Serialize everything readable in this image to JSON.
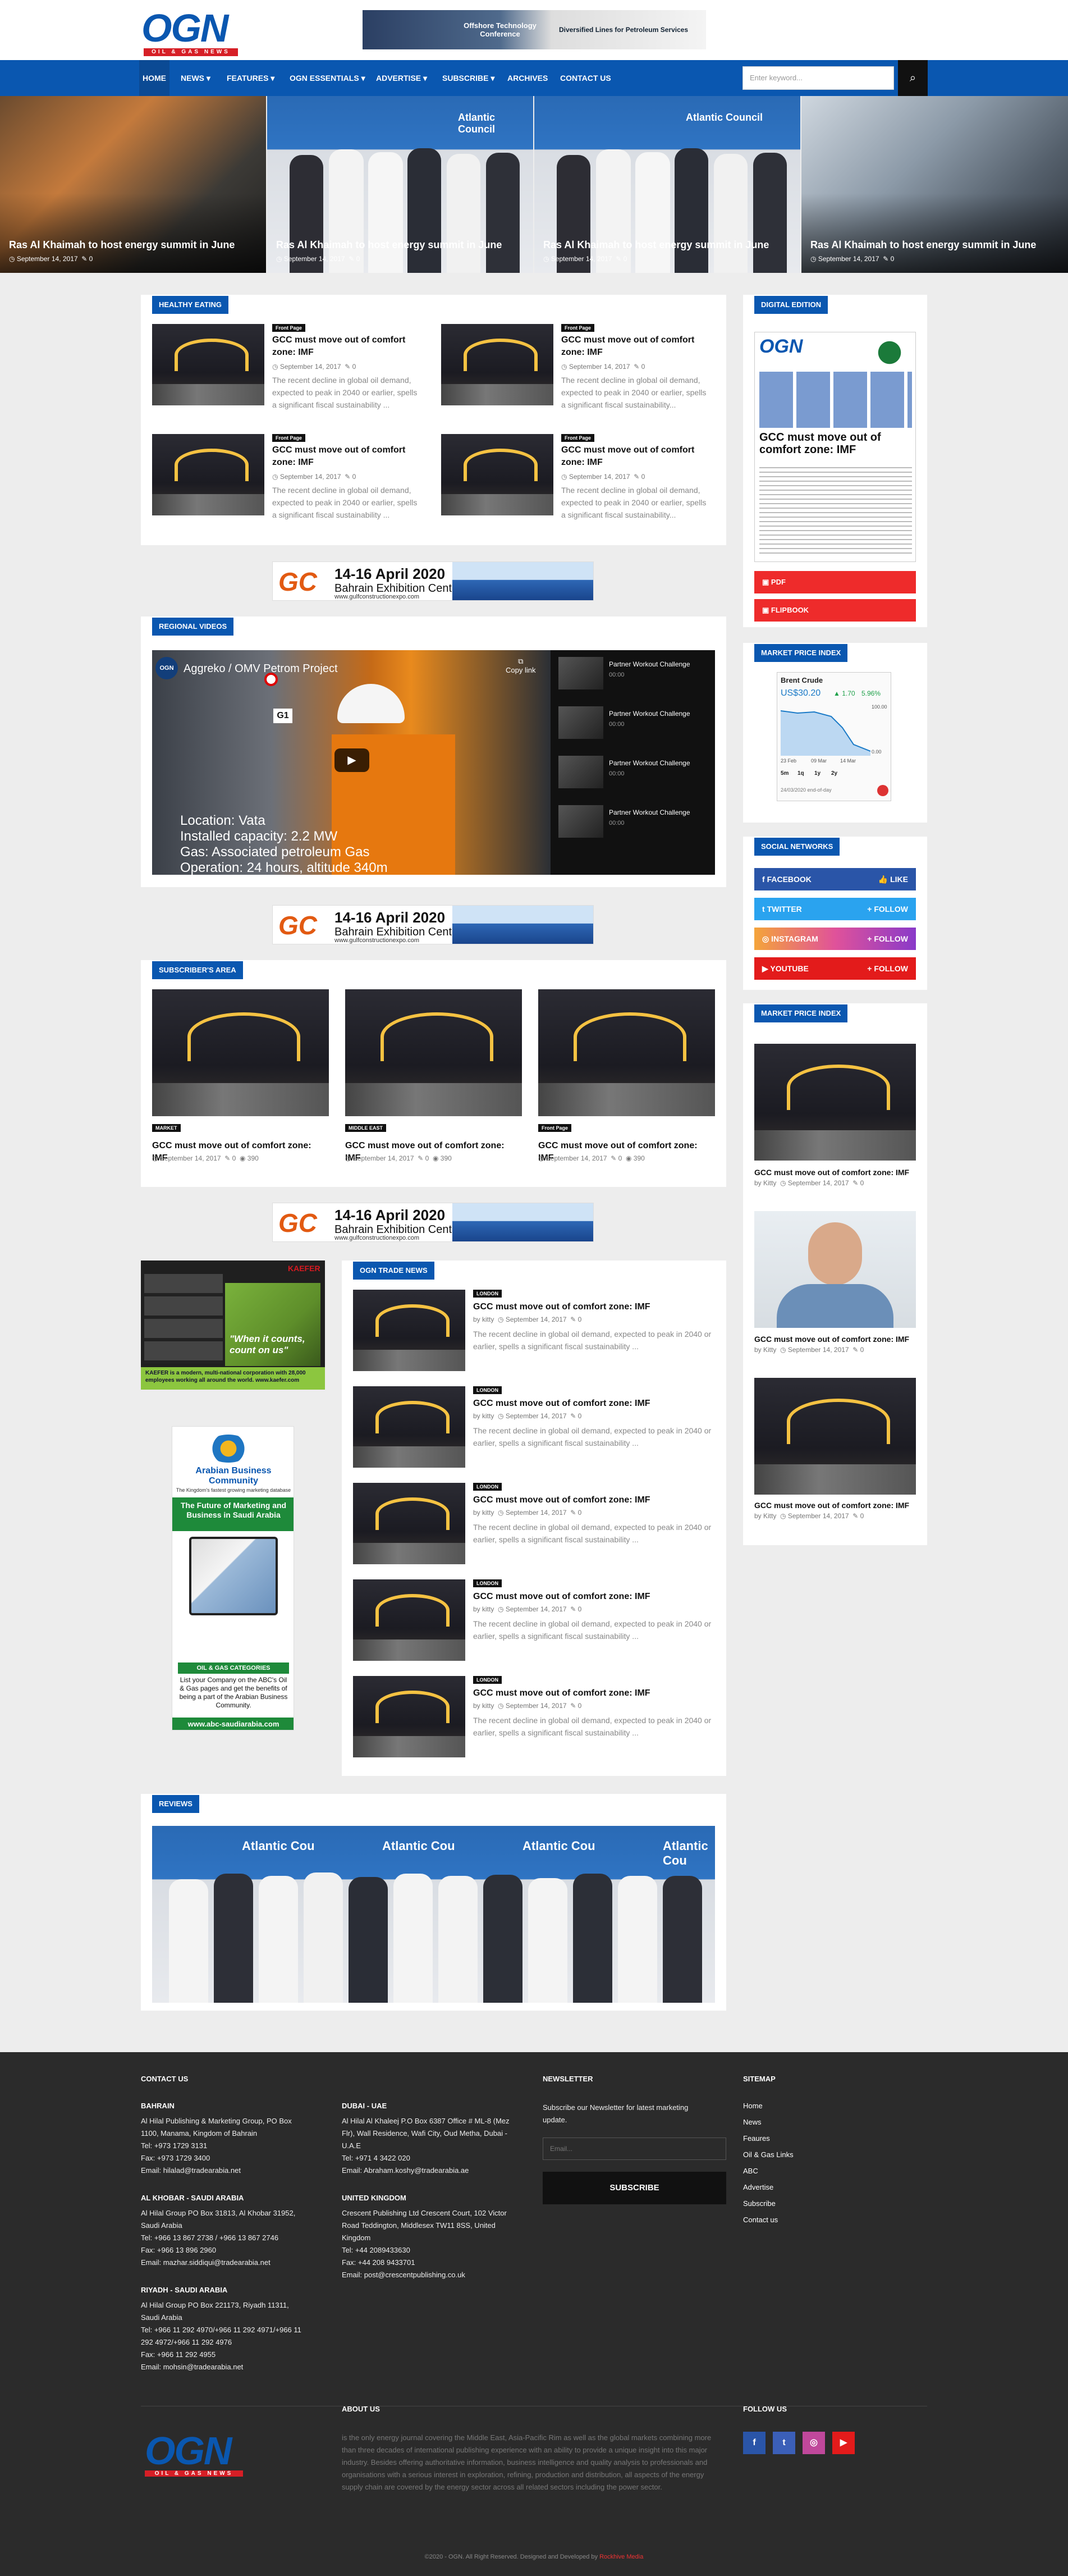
{
  "header": {
    "logo_text": "OGN",
    "logo_subtitle": "OIL & GAS NEWS",
    "ad_left": "Offshore Technology Conference",
    "ad_right": "Diversified Lines for Petroleum Services"
  },
  "nav": {
    "items": [
      "HOME",
      "NEWS ▾",
      "FEATURES ▾",
      "OGN ESSENTIALS ▾",
      "ADVERTISE ▾",
      "SUBSCRIBE ▾",
      "ARCHIVES",
      "CONTACT US"
    ],
    "search_placeholder": "Enter keyword...",
    "search_icon": "search-icon"
  },
  "hero": [
    {
      "title": "Ras Al Khaimah to host energy summit in June",
      "date": "September 14, 2017",
      "comments": "0"
    },
    {
      "title": "Ras Al Khaimah to host energy summit in June",
      "date": "September 14, 2017",
      "comments": "0"
    },
    {
      "title": "Ras Al Khaimah to host energy summit in June",
      "date": "September 14, 2017",
      "comments": "0"
    },
    {
      "title": "Ras Al Khaimah to host energy summit in June",
      "date": "September 14, 2017",
      "comments": "0"
    }
  ],
  "hero_overlay": "Atlantic Council",
  "healthy": {
    "tag": "HEALTHY EATING",
    "items": [
      {
        "label": "Front Page",
        "title": "GCC must move out of comfort zone: IMF",
        "date": "September 14, 2017",
        "comments": "0",
        "excerpt": "The recent decline in global oil demand, expected to peak in 2040 or earlier, spells a significant fiscal sustainability ..."
      },
      {
        "label": "Front Page",
        "title": "GCC must move out of comfort zone: IMF",
        "date": "September 14, 2017",
        "comments": "0",
        "excerpt": "The recent decline in global oil demand, expected to peak in 2040 or earlier, spells a significant fiscal sustainability..."
      },
      {
        "label": "Front Page",
        "title": "GCC must move out of comfort zone: IMF",
        "date": "September 14, 2017",
        "comments": "0",
        "excerpt": "The recent decline in global oil demand, expected to peak in 2040 or earlier, spells a significant fiscal sustainability ..."
      },
      {
        "label": "Front Page",
        "title": "GCC must move out of comfort zone: IMF",
        "date": "September 14, 2017",
        "comments": "0",
        "excerpt": "The recent decline in global oil demand, expected to peak in 2040 or earlier, spells a significant fiscal sustainability..."
      }
    ]
  },
  "banner": {
    "logo": "GC",
    "dates": "14-16 April 2020",
    "venue": "Bahrain Exhibition Centre",
    "url": "www.gulfconstructionexpo.com"
  },
  "videos": {
    "tag": "REGIONAL VIDEOS",
    "main_title": "Aggreko / OMV Petrom Project",
    "copy_link": "Copy link",
    "caption": [
      "Location: Vata",
      "Installed capacity: 2.2 MW",
      "Gas: Associated petroleum Gas",
      "Operation: 24 hours, altitude 340m"
    ],
    "sign": "G1",
    "list": [
      {
        "title": "Partner Workout Challenge",
        "time": "00:00"
      },
      {
        "title": "Partner Workout Challenge",
        "time": "00:00"
      },
      {
        "title": "Partner Workout Challenge",
        "time": "00:00"
      },
      {
        "title": "Partner Workout Challenge",
        "time": "00:00"
      }
    ]
  },
  "subscribers": {
    "tag": "SUBSCRIBER'S AREA",
    "items": [
      {
        "label": "MARKET",
        "title": "GCC must move out of comfort zone: IMF",
        "date": "September 14, 2017",
        "comments": "0",
        "views": "390"
      },
      {
        "label": "MIDDLE EAST",
        "title": "GCC must move out of comfort zone: IMF",
        "date": "September 14, 2017",
        "comments": "0",
        "views": "390"
      },
      {
        "label": "Front Page",
        "title": "GCC must move out of comfort zone: IMF",
        "date": "September 14, 2017",
        "comments": "0",
        "views": "390"
      }
    ]
  },
  "trade": {
    "tag": "OGN TRADE NEWS",
    "items": [
      {
        "label": "LONDON",
        "title": "GCC must move out of comfort zone: IMF",
        "author": "by kitty",
        "date": "September 14, 2017",
        "comments": "0",
        "excerpt": "The recent decline in global oil demand, expected to peak in 2040 or earlier, spells a significant fiscal sustainability ..."
      },
      {
        "label": "LONDON",
        "title": "GCC must move out of comfort zone: IMF",
        "author": "by kitty",
        "date": "September 14, 2017",
        "comments": "0",
        "excerpt": "The recent decline in global oil demand, expected to peak in 2040 or earlier, spells a significant fiscal sustainability ..."
      },
      {
        "label": "LONDON",
        "title": "GCC must move out of comfort zone: IMF",
        "author": "by kitty",
        "date": "September 14, 2017",
        "comments": "0",
        "excerpt": "The recent decline in global oil demand, expected to peak in 2040 or earlier, spells a significant fiscal sustainability ..."
      },
      {
        "label": "LONDON",
        "title": "GCC must move out of comfort zone: IMF",
        "author": "by kitty",
        "date": "September 14, 2017",
        "comments": "0",
        "excerpt": "The recent decline in global oil demand, expected to peak in 2040 or earlier, spells a significant fiscal sustainability ..."
      },
      {
        "label": "LONDON",
        "title": "GCC must move out of comfort zone: IMF",
        "author": "by kitty",
        "date": "September 14, 2017",
        "comments": "0",
        "excerpt": "The recent decline in global oil demand, expected to peak in 2040 or earlier, spells a significant fiscal sustainability ..."
      }
    ]
  },
  "ads": {
    "kaefer_quote": "\"When it counts, count on us\"",
    "kaefer_brand": "KAEFER",
    "kaefer_text": "KAEFER is a modern, multi-national corporation with 28,000 employees working all around the world. www.kaefer.com",
    "abc_title": "Arabian Business Community",
    "abc_tagline": "The Kingdom's fastest growing marketing database",
    "abc_headline": "The Future of Marketing and Business in Saudi Arabia",
    "abc_category": "OIL & GAS CATEGORIES",
    "abc_text": "List your Company on the ABC's Oil & Gas pages and get the benefits of being a part of the Arabian Business Community.",
    "abc_url": "www.abc-saudiarabia.com"
  },
  "reviews": {
    "tag": "REVIEWS",
    "overlay": "Atlantic Cou"
  },
  "sidebar": {
    "digital": {
      "tag": "DIGITAL EDITION",
      "cover_logo": "OGN",
      "cover_headline": "GCC must move out of comfort zone: IMF",
      "pdf": "PDF",
      "flipbook": "FLIPBOOK"
    },
    "market": {
      "tag": "MARKET PRICE INDEX",
      "name": "Brent Crude",
      "price": "US$30.20",
      "change": "▲ 1.70",
      "pct": "5.96%",
      "y_top": "100.00",
      "y_bottom": "0.00",
      "dates": [
        "23 Feb",
        "09 Mar",
        "14 Mar"
      ],
      "ranges": [
        "5m",
        "1q",
        "1y",
        "2y"
      ],
      "footer": "24/03/2020 end-of-day"
    },
    "social": {
      "tag": "SOCIAL NETWORKS",
      "items": [
        {
          "name": "FACEBOOK",
          "action": "LIKE",
          "color": "#2a55a8"
        },
        {
          "name": "TWITTER",
          "action": "FOLLOW",
          "color": "#2aa3ef"
        },
        {
          "name": "INSTAGRAM",
          "action": "FOLLOW",
          "color": "#e0529a"
        },
        {
          "name": "YOUTUBE",
          "action": "FOLLOW",
          "color": "#e31b1b"
        }
      ]
    },
    "market2": {
      "tag": "MARKET PRICE INDEX",
      "items": [
        {
          "title": "GCC must move out of comfort zone: IMF",
          "author": "by Kitty",
          "date": "September 14, 2017",
          "comments": "0"
        },
        {
          "title": "GCC must move out of comfort zone: IMF",
          "author": "by Kitty",
          "date": "September 14, 2017",
          "comments": "0"
        },
        {
          "title": "GCC must move out of comfort zone: IMF",
          "author": "by Kitty",
          "date": "September 14, 2017",
          "comments": "0"
        }
      ]
    }
  },
  "footer": {
    "contact_head": "CONTACT US",
    "bahrain": {
      "head": "BAHRAIN",
      "lines": [
        "Al Hilal Publishing & Marketing Group, PO Box 1100, Manama, Kingdom of Bahrain",
        "Tel: +973 1729 3131",
        "Fax: +973 1729 3400",
        "Email: hilalad@tradearabia.net"
      ]
    },
    "khobar": {
      "head": "AL KHOBAR - SAUDI ARABIA",
      "lines": [
        "Al Hilal Group PO Box 31813, Al Khobar 31952, Saudi Arabia",
        "Tel: +966 13 867 2738 / +966 13 867 2746",
        "Fax: +966 13 896 2960",
        "Email: mazhar.siddiqui@tradearabia.net"
      ]
    },
    "riyadh": {
      "head": "RIYADH - SAUDI ARABIA",
      "lines": [
        "Al Hilal Group PO Box 221173, Riyadh 11311, Saudi Arabia",
        "Tel: +966 11 292 4970/+966 11 292 4971/+966 11 292 4972/+966 11 292 4976",
        "Fax: +966 11 292 4955",
        "Email: mohsin@tradearabia.net"
      ]
    },
    "dubai": {
      "head": "DUBAI - UAE",
      "lines": [
        "Al Hilal Al Khaleej P.O Box 6387 Office # ML-8 (Mez Flr), Wall Residence, Wafi City, Oud Metha, Dubai - U.A.E",
        "Tel: +971 4 3422 020",
        "Email: Abraham.koshy@tradearabia.ae"
      ]
    },
    "uk": {
      "head": "UNITED KINGDOM",
      "lines": [
        "Crescent Publishing Ltd Crescent Court, 102 Victor Road Teddington, Middlesex TW11 8SS, United Kingdom",
        "Tel: +44 2089433630",
        "Fax: +44 208 9433701",
        "Email: post@crescentpublishing.co.uk"
      ]
    },
    "newsletter": {
      "head": "NEWSLETTER",
      "text": "Subscribe our Newsletter for latest marketing update.",
      "placeholder": "Email...",
      "button": "SUBSCRIBE"
    },
    "sitemap": {
      "head": "SITEMAP",
      "links": [
        "Home",
        "News",
        "Feaures",
        "Oil & Gas Links",
        "ABC",
        "Advertise",
        "Subscribe",
        "Contact us"
      ]
    },
    "about": {
      "head": "ABOUT US",
      "text": "is the only energy journal covering the Middle East, Asia-Pacific Rim as well as the global markets combining more than three decades of international publishing experience with an ability to provide a unique insight into this major industry. Besides offering authoritative information, business intelligence and quality analysis to professionals and organisations with a serious interest in exploration, refining, production and distribution, all aspects of the energy supply chain are covered by the energy sector across all related sectors including the power sector."
    },
    "follow": {
      "head": "FOLLOW US",
      "icons": [
        {
          "glyph": "f",
          "color": "#2a55a8"
        },
        {
          "glyph": "t",
          "color": "#3b5fb8"
        },
        {
          "glyph": "◎",
          "color": "#c0489b"
        },
        {
          "glyph": "▶",
          "color": "#e31b1b"
        }
      ]
    },
    "copyright": "©2020 - OGN. All Right Reserved. Designed and Developed by",
    "developer": "Rockhive Media"
  }
}
